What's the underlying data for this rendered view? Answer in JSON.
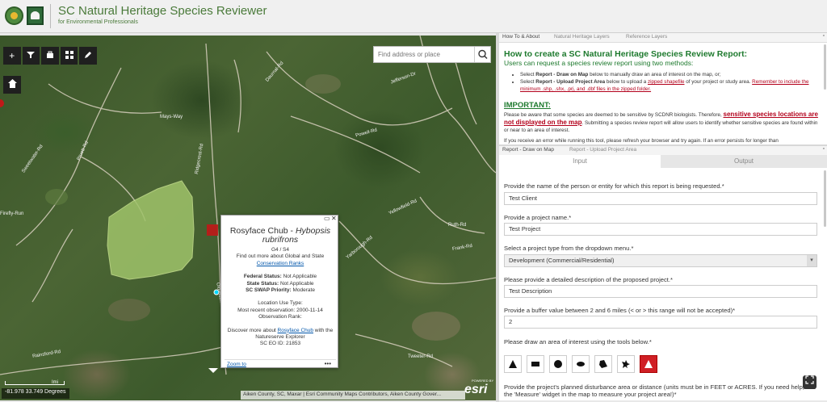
{
  "header": {
    "title": "SC Natural Heritage Species Reviewer",
    "subtitle": "for Environmental Professionals"
  },
  "map": {
    "search": {
      "placeholder": "Find address or place"
    },
    "toolbar": {
      "zoom_in": "+",
      "home": "⌂"
    },
    "road_labels": [
      "Mays-Way",
      "Jefferson-Dr",
      "Daurnal-Rd",
      "Powell-Rd",
      "Sweetwater-Rd",
      "Pruett-Rd",
      "Ridgecrest-Rd",
      "Yellowfield-Rd",
      "Yarborough-Rd",
      "Ruth-Rd",
      "Frank-Rd",
      "Rainsford-Rd",
      "Firefly-Run",
      "Tweeter-Rd",
      "Old-Buck-Rd"
    ],
    "scale_label": "Imi",
    "coordinates": "-81.978 33.749 Degrees",
    "attribution": "Aiken County, SC, Maxar | Esri Community Maps Contributors, Aiken County Gover...",
    "esri_powered": "POWERED BY",
    "esri_logo": "esri"
  },
  "popup": {
    "title_common": "Rosyface Chub - ",
    "title_scientific": "Hybopsis rubrifrons",
    "rank": "G4 / S4",
    "rank_info_pre": "Find out more about Global and State ",
    "rank_info_link": "Conservation Ranks",
    "federal_status_label": "Federal Status:",
    "federal_status_value": "Not Applicable",
    "state_status_label": "State Status:",
    "state_status_value": "Not Applicable",
    "swap_label": "SC SWAP Priority:",
    "swap_value": "Moderate",
    "location_use": "Location Use Type:",
    "recent_obs": "Most recent observation: 2000-11-14",
    "obs_rank": "Observation Rank:",
    "discover_pre": "Discover more about ",
    "discover_link": "Rosyface Chub",
    "discover_post": " with the Natureserve Explorer",
    "eo_id": "SC EO ID: 21853",
    "zoom_to": "Zoom to",
    "more": "•••"
  },
  "top_panel": {
    "tabs": [
      "How To & About",
      "Natural Heritage Layers",
      "Reference Layers"
    ],
    "howto_title": "How to create a SC Natural Heritage Species Review Report:",
    "howto_sub": "Users can request a species review report using two methods:",
    "bullet1_pre": "Select ",
    "bullet1_bold": "Report - Draw on Map",
    "bullet1_post": " below to manually draw an area of interest on the map, or;",
    "bullet2_pre": "Select ",
    "bullet2_bold": "Report - Upload Project Area",
    "bullet2_mid": " below to upload a ",
    "bullet2_link": "zipped shapefile",
    "bullet2_mid2": " of your project or study area. ",
    "bullet2_link2": "Remember to include the minimum .shp, .shx, .prj, and .dbf files in the zipped folder.",
    "important": "IMPORTANT:",
    "imp_pre": "Please be aware that some species are deemed to be sensitive by SCDNR biologists. Therefore, ",
    "imp_red": "sensitive species locations are not displayed on the map",
    "imp_post": ". Submitting a species review report will allow users to identify whether sensitive species are found within or near to an area of interest.",
    "cutoff": "If you receive an error while running this tool, please refresh your browser and try again. If an error persists for longer than"
  },
  "bottom_panel": {
    "tabs": [
      "Report - Draw on Map",
      "Report - Upload Project Area"
    ],
    "io_tabs": [
      "Input",
      "Output"
    ],
    "q1": "Provide the name of the person or entity for which this report is being requested.*",
    "a1": "Test Client",
    "q2": "Provide a project name.*",
    "a2": "Test Project",
    "q3": "Select a project type from the dropdown menu.*",
    "a3": "Development (Commercial/Residential)",
    "q4": "Please provide a detailed description of the proposed project.*",
    "a4": "Test Description",
    "q5": "Provide a buffer value between 2 and 6 miles (< or > this range will not be accepted)*",
    "a5": "2",
    "q6": "Please draw an area of interest using the tools below.*",
    "draw_tools": [
      "point-icon",
      "rectangle-icon",
      "circle-icon",
      "ellipse-icon",
      "polygon-icon",
      "freehand-icon",
      "triangle-icon"
    ],
    "q7_pre": "Provide the project's planned disturbance area or distance (units must be in FEET or ACRES. If you need help, use the 'Measure' widget in the map to measure your project area!)*",
    "accent": "#d01f25"
  }
}
